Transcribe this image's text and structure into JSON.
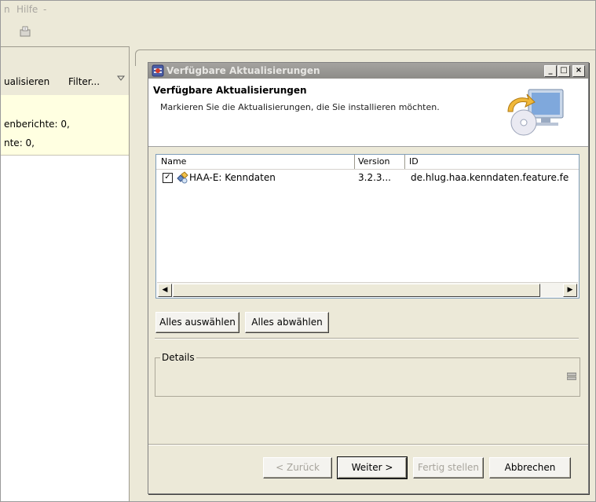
{
  "menubar": {
    "item_left": "n",
    "item_help": "Hilfe"
  },
  "left_view": {
    "toolbar_update": "ualisieren",
    "toolbar_filter": "Filter...",
    "line1": "enberichte: 0,",
    "line2": "nte: 0,"
  },
  "dialog": {
    "title": "Verfügbare Aktualisierungen",
    "header_title": "Verfügbare Aktualisierungen",
    "header_description": "Markieren Sie die Aktualisierungen, die Sie installieren möchten.",
    "window_buttons": {
      "minimize": "_",
      "maximize": "□",
      "close": "×"
    },
    "table": {
      "columns": [
        "Name",
        "Version",
        "ID"
      ],
      "rows": [
        {
          "checked": true,
          "name": "HAA-E: Kenndaten",
          "version": "3.2.3...",
          "id": "de.hlug.haa.kenndaten.feature.fe"
        }
      ]
    },
    "select_all": "Alles auswählen",
    "deselect_all": "Alles abwählen",
    "details_label": "Details",
    "buttons": {
      "back": "< Zurück",
      "next": "Weiter >",
      "finish": "Fertig stellen",
      "cancel": "Abbrechen"
    }
  },
  "icons": {
    "dialog_title_icon": "eclipse-update-icon",
    "header_graphic": "computer-cd-update-icon",
    "feature_icon": "feature-plugin-icon"
  },
  "colors": {
    "dialog_bg": "#ece9d8",
    "titlebar_inactive": "#9a9894",
    "tooltip_yellow": "#ffffe1"
  }
}
